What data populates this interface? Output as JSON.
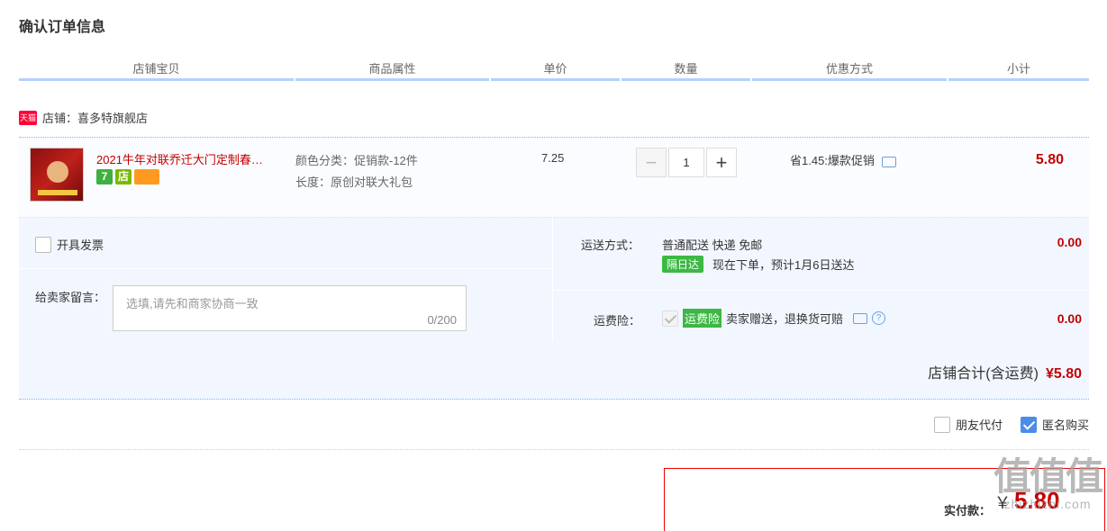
{
  "page": {
    "title": "确认订单信息"
  },
  "table_headers": [
    "店铺宝贝",
    "商品属性",
    "单价",
    "数量",
    "优惠方式",
    "小计"
  ],
  "shop": {
    "badge": "天猫",
    "name": "店铺：喜多特旗舰店"
  },
  "item": {
    "title": "2021牛年对联乔迁大门定制春…",
    "attr_color": "颜色分类：促销款-12件",
    "attr_length": "长度：原创对联大礼包",
    "unit_price": "7.25",
    "quantity": "1",
    "qty_minus": "−",
    "qty_plus": "+",
    "promotion": "省1.45:爆款促销",
    "subtotal": "5.80",
    "badges": [
      "7",
      "店"
    ]
  },
  "invoice": {
    "label": "开具发票"
  },
  "memo": {
    "label": "给卖家留言：",
    "placeholder": "选填,请先和商家协商一致",
    "count": "0/200"
  },
  "shipping": {
    "label": "运送方式：",
    "method": "普通配送 快递 免邮",
    "badge": "隔日达",
    "eta": "现在下单，预计1月6日送达",
    "fee": "0.00"
  },
  "insurance": {
    "label": "运费险：",
    "badge": "运费险",
    "desc": "卖家赠送，退换货可赔",
    "fee": "0.00"
  },
  "shop_total": {
    "label": "店铺合计(含运费)",
    "value": "¥5.80"
  },
  "options": {
    "friend_pay": "朋友代付",
    "anonymous": "匿名购买"
  },
  "payment": {
    "label": "实付款：",
    "currency": "￥",
    "value": "5.80"
  },
  "watermark": {
    "logo": "值值值",
    "url": "zhizhizhi.com"
  }
}
